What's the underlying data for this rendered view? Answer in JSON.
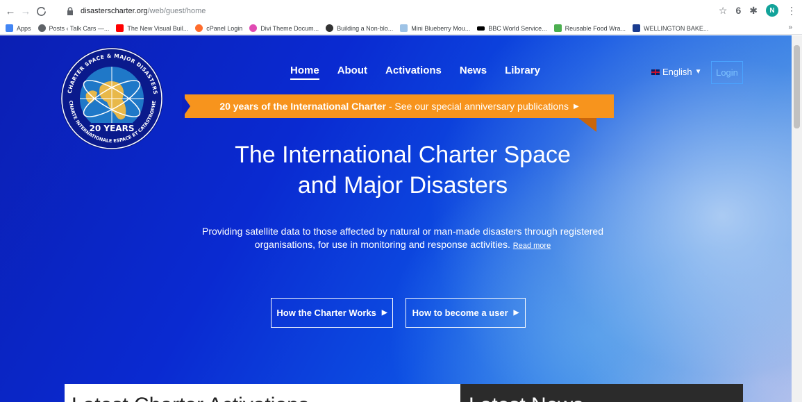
{
  "browser": {
    "url_host": "disasterscharter.org",
    "url_path": "/web/guest/home",
    "avatar_initial": "N",
    "bookmarks": [
      {
        "label": "Apps",
        "color": "#4285f4"
      },
      {
        "label": "Posts ‹ Talk Cars —...",
        "color": "#5f6368"
      },
      {
        "label": "The New Visual Buil...",
        "color": "#ff0000"
      },
      {
        "label": "cPanel Login",
        "color": "#ff6c2c"
      },
      {
        "label": "Divi Theme Docum...",
        "color": "#e04bb3"
      },
      {
        "label": "Building a Non-blo...",
        "color": "#333333"
      },
      {
        "label": "Mini Blueberry Mou...",
        "color": "#9ec3e6"
      },
      {
        "label": "BBC World Service...",
        "color": "#000000"
      },
      {
        "label": "Reusable Food Wra...",
        "color": "#4caf50"
      },
      {
        "label": "WELLINGTON BAKE...",
        "color": "#1a3c8f"
      }
    ],
    "bookmarks_more": "»"
  },
  "logo": {
    "ring_text_top": "CHARTER SPACE & MAJOR DISASTERS",
    "ring_text_bottom": "CHARTE INTERNATIONALE ESPACE ET CATASTROPHES MAJEURES",
    "left_text": "INTERNATIONAL",
    "badge": "20 YEARS"
  },
  "nav": {
    "items": [
      "Home",
      "About",
      "Activations",
      "News",
      "Library"
    ],
    "language": "English",
    "login": "Login"
  },
  "banner": {
    "bold": "20 years of the International Charter",
    "rest": " - See our special anniversary publications"
  },
  "hero": {
    "title_line1": "The International Charter Space",
    "title_line2": "and Major Disasters",
    "description": "Providing satellite data to those affected by natural or man-made disasters through registered organisations, for use in monitoring and response activities.",
    "read_more": "Read more"
  },
  "cta": {
    "works": "How the Charter Works",
    "user": "How to become a user"
  },
  "cards": {
    "left": "Latest Charter Activations",
    "right": "Latest News"
  },
  "colors": {
    "accent_orange": "#f7941d",
    "login_blue": "#4aa3ff",
    "hero_blue": "#0b22c0"
  }
}
